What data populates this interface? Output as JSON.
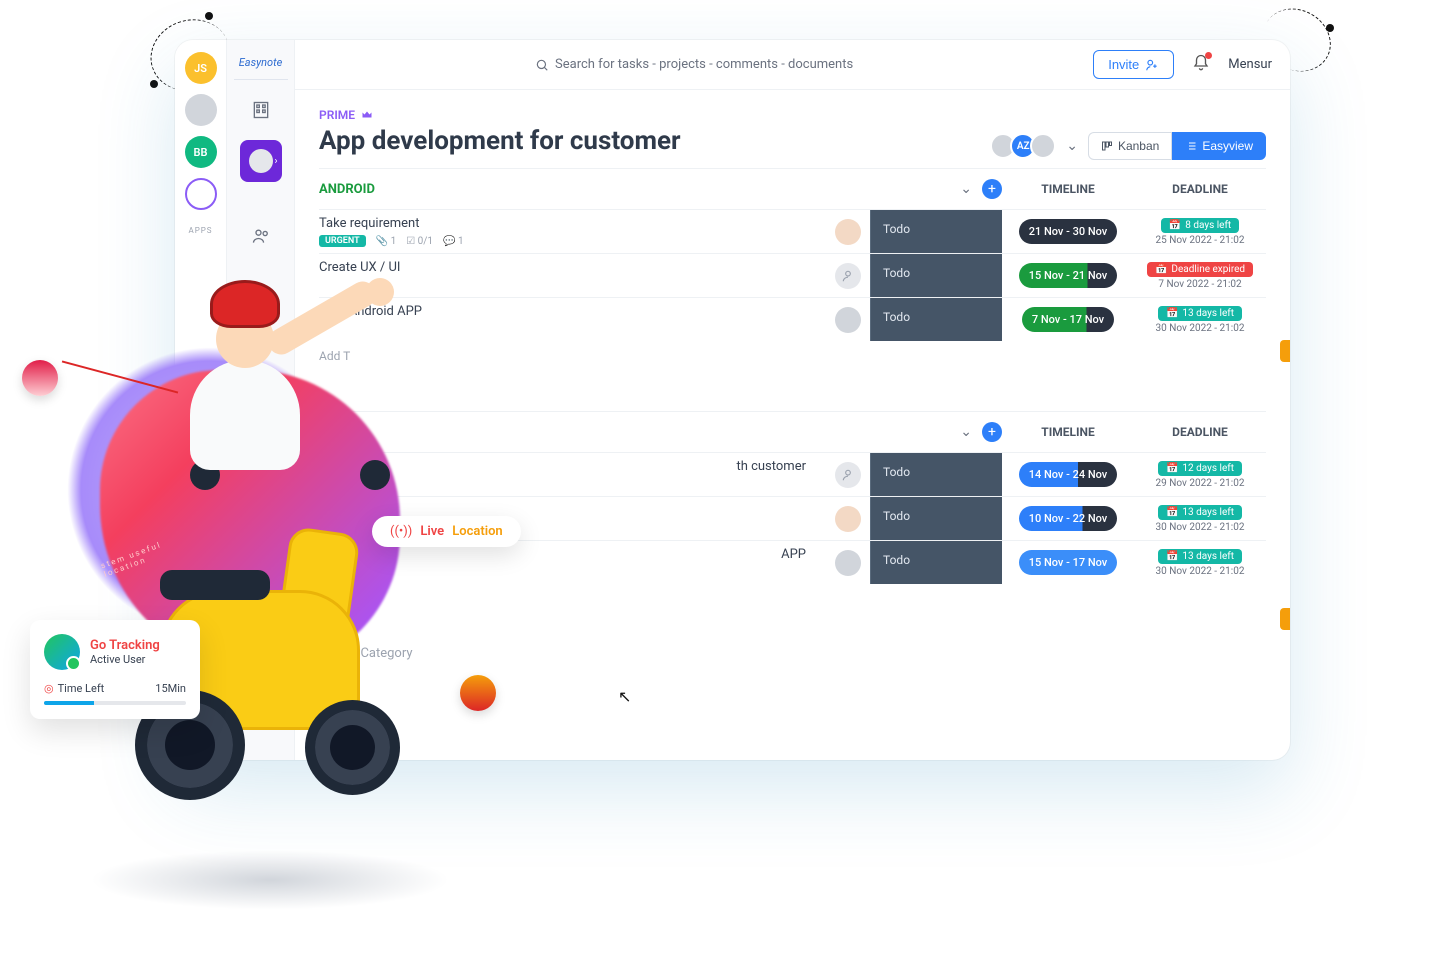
{
  "header": {
    "logo": "Easynote",
    "search_placeholder": "Search for tasks - projects - comments - documents",
    "invite": "Invite",
    "username": "Mensur"
  },
  "sidebar": {
    "avatars": [
      "JS",
      "",
      "BB",
      ""
    ],
    "apps_label": "APPS"
  },
  "page": {
    "prime": "PRIME",
    "title": "App development for customer",
    "avatars": [
      "",
      "AZ",
      ""
    ],
    "view_kanban": "Kanban",
    "view_easy": "Easyview"
  },
  "columns": {
    "timeline": "TIMELINE",
    "deadline": "DEADLINE"
  },
  "sections": [
    {
      "name": "ANDROID",
      "rows": [
        {
          "task": "Take requirement",
          "urgent": "URGENT",
          "attach": "1",
          "check": "0/1",
          "comment": "1",
          "assignee": "avatar",
          "status": "Todo",
          "timeline": "21 Nov - 30 Nov",
          "tl_style": "tl-dark",
          "deadline_chip": "8 days left",
          "dl_class": "dl-teal",
          "deadline": "25 Nov 2022 - 21:02"
        },
        {
          "task": "Create UX / UI",
          "assignee": "unassigned",
          "status": "Todo",
          "timeline": "15 Nov - 21 Nov",
          "tl_style": "tl-green",
          "deadline_chip": "Deadline expired",
          "dl_class": "dl-red",
          "deadline": "7 Nov 2022 - 21:02"
        },
        {
          "task": "ta of Android APP",
          "assignee": "avatar",
          "status": "Todo",
          "timeline": "7 Nov - 17 Nov",
          "tl_style": "tl-green",
          "deadline_chip": "13 days left",
          "dl_class": "dl-teal",
          "deadline": "30 Nov 2022 - 21:02"
        }
      ],
      "add": "Add T"
    },
    {
      "name": "",
      "rows": [
        {
          "task": "th customer",
          "assignee": "unassigned",
          "status": "Todo",
          "timeline": "14 Nov - 24 Nov",
          "tl_style": "tl-blue1",
          "deadline_chip": "12 days left",
          "dl_class": "dl-teal",
          "deadline": "29 Nov 2022 - 21:02"
        },
        {
          "task": "",
          "assignee": "avatar",
          "status": "Todo",
          "timeline": "10 Nov - 22 Nov",
          "tl_style": "tl-blue2",
          "deadline_chip": "13 days left",
          "dl_class": "dl-teal",
          "deadline": "30 Nov 2022 - 21:02"
        },
        {
          "task": "APP",
          "assignee": "avatar",
          "status": "Todo",
          "timeline": "15 Nov - 17 Nov",
          "tl_style": "tl-blue3",
          "deadline_chip": "13 days left",
          "dl_class": "dl-teal",
          "deadline": "30 Nov 2022 - 21:02"
        }
      ],
      "add": ""
    }
  ],
  "add_category": "Add Category",
  "overlay": {
    "live1": "Live",
    "live2": "Location",
    "card_title": "Go Tracking",
    "card_sub": "Active User",
    "time_left_label": "Time Left",
    "time_left_value": "15Min",
    "circle_text": "stem useful location"
  }
}
